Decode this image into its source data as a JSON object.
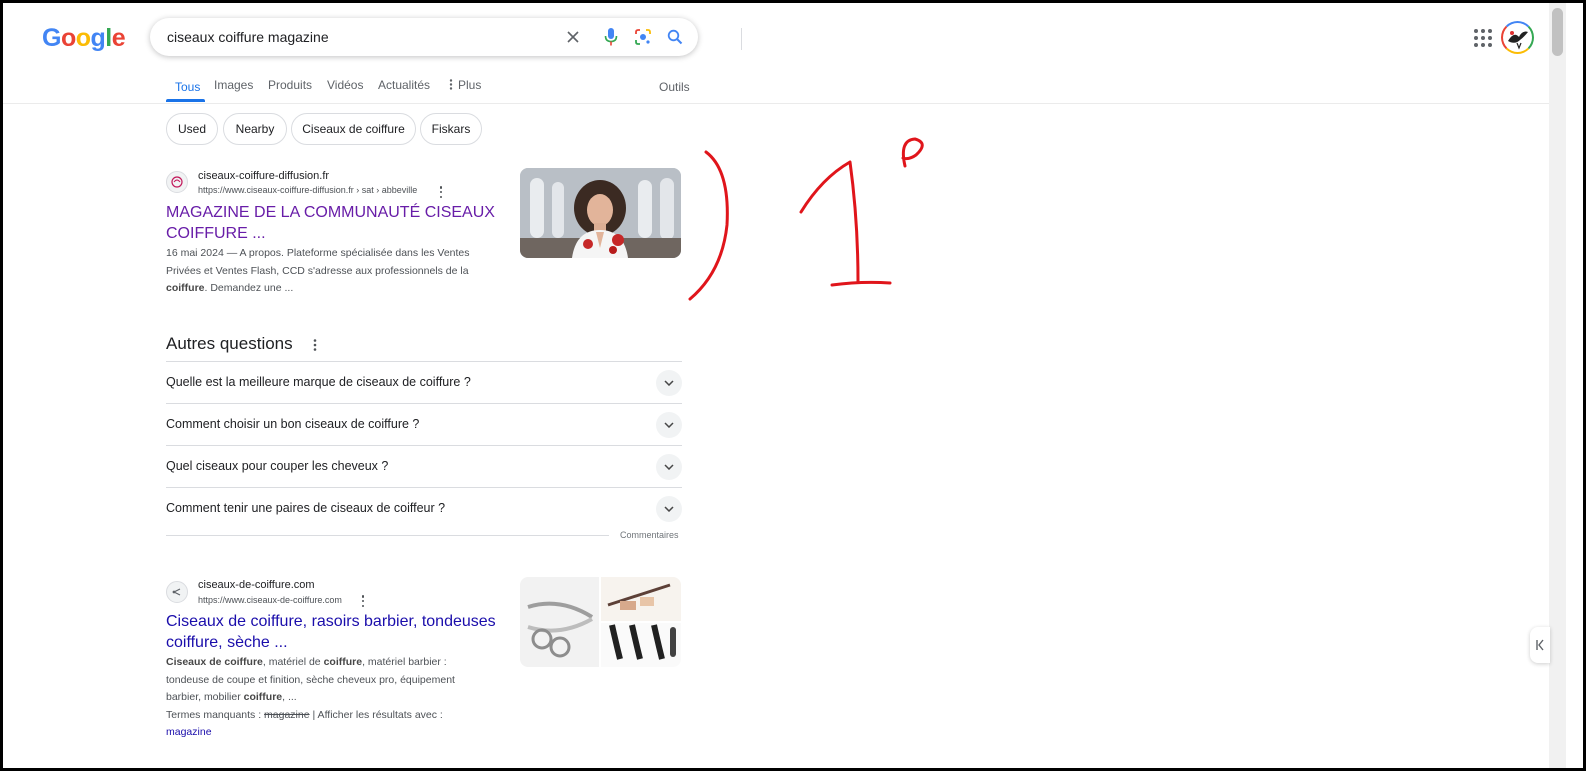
{
  "header": {
    "logo_text": "Google",
    "search_query": "ciseaux coiffure magazine",
    "icons": [
      "clear-icon",
      "mic-icon",
      "lens-icon",
      "search-icon",
      "apps-icon",
      "avatar"
    ]
  },
  "tabs": [
    {
      "label": "Tous",
      "active": true
    },
    {
      "label": "Images"
    },
    {
      "label": "Produits"
    },
    {
      "label": "Vidéos"
    },
    {
      "label": "Actualités"
    },
    {
      "label": "Plus"
    }
  ],
  "tools_label": "Outils",
  "chips": [
    "Used",
    "Nearby",
    "Ciseaux de coiffure",
    "Fiskars"
  ],
  "results": [
    {
      "site": "ciseaux-coiffure-diffusion.fr",
      "url": "https://www.ciseaux-coiffure-diffusion.fr › sat › abbeville",
      "title_line1": "MAGAZINE DE LA COMMUNAUTÉ CISEAUX",
      "title_line2": "COIFFURE ...",
      "snippet_date": "16 mai 2024 — ",
      "snippet_a": "A propos. Plateforme spécialisée dans les Ventes",
      "snippet_b": "Privées et Ventes Flash, CCD s'adresse aux professionnels de la",
      "snippet_c_bold": "coiffure",
      "snippet_c": ". Demandez une ..."
    },
    {
      "site": "ciseaux-de-coiffure.com",
      "url": "https://www.ciseaux-de-coiffure.com",
      "title_line1": "Ciseaux de coiffure, rasoirs barbier, tondeuses",
      "title_line2": "coiffure, sèche ...",
      "s1_bold_a": "Ciseaux de coiffure",
      "s1_a": ", matériel de ",
      "s1_bold_b": "coiffure",
      "s1_b": ", matériel barbier :",
      "s2": "tondeuse de coupe et finition, sèche cheveux pro, équipement",
      "s3_a": "barbier, mobilier ",
      "s3_bold": "coiffure",
      "s3_b": ", ...",
      "missing_label": "Termes manquants : ",
      "missing_term": "magazine",
      "missing_sep": " | Afficher les résultats avec :",
      "missing_link": "magazine"
    }
  ],
  "paa": {
    "title": "Autres questions",
    "questions": [
      "Quelle est la meilleure marque de ciseaux de coiffure ?",
      "Comment choisir un bon ciseaux de coiffure ?",
      "Quel ciseaux pour couper les cheveux ?",
      "Comment tenir une paires de ciseaux de coiffeur ?"
    ],
    "feedback_label": "Commentaires"
  },
  "annotation": {
    "color": "#e0151b",
    "description_text": ""
  },
  "colors": {
    "link": "#1a0dab",
    "visited": "#681da8",
    "accent": "#1a73e8"
  }
}
